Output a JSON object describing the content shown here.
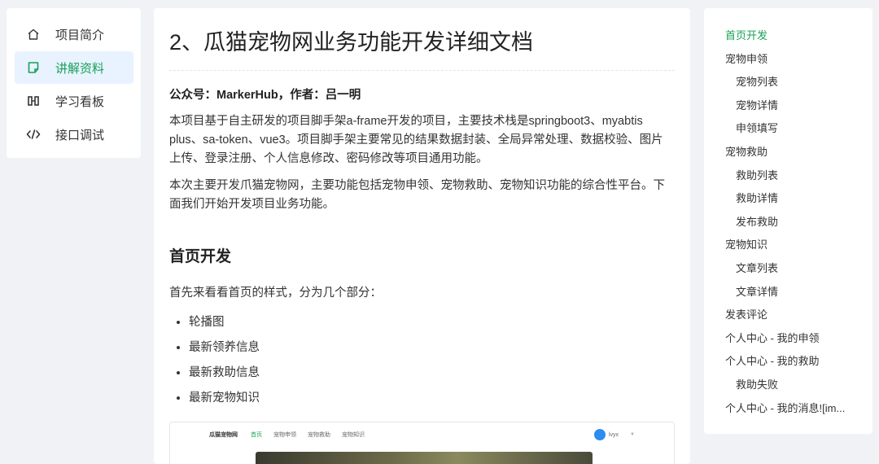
{
  "nav": {
    "items": [
      {
        "label": "项目简介",
        "icon": "home-icon"
      },
      {
        "label": "讲解资料",
        "icon": "note-icon",
        "active": true
      },
      {
        "label": "学习看板",
        "icon": "board-icon"
      },
      {
        "label": "接口调试",
        "icon": "code-icon"
      }
    ],
    "accent_color": "#18a058",
    "active_bg": "#e8f3ff"
  },
  "doc": {
    "title": "2、瓜猫宠物网业务功能开发详细文档",
    "byline": "公众号：MarkerHub，作者：吕一明",
    "para1": "本项目基于自主研发的项目脚手架a-frame开发的项目，主要技术栈是springboot3、myabtis plus、sa-token、vue3。项目脚手架主要常见的结果数据封装、全局异常处理、数据校验、图片上传、登录注册、个人信息修改、密码修改等项目通用功能。",
    "para2": "本次主要开发爪猫宠物网，主要功能包括宠物申领、宠物救助、宠物知识功能的综合性平台。下面我们开始开发项目业务功能。",
    "section_heading": "首页开发",
    "section_intro": "首先来看看首页的样式，分为几个部分：",
    "bullets": [
      "轮播图",
      "最新领养信息",
      "最新救助信息",
      "最新宠物知识"
    ],
    "screenshot": {
      "logo": "瓜猫宠物网",
      "tabs": [
        "首页",
        "宠物申领",
        "宠物救助",
        "宠物知识"
      ],
      "user": "lvyx"
    }
  },
  "toc": {
    "items": [
      {
        "label": "首页开发",
        "level": 1,
        "active": true
      },
      {
        "label": "宠物申领",
        "level": 1
      },
      {
        "label": "宠物列表",
        "level": 2
      },
      {
        "label": "宠物详情",
        "level": 2
      },
      {
        "label": "申领填写",
        "level": 2
      },
      {
        "label": "宠物救助",
        "level": 1
      },
      {
        "label": "救助列表",
        "level": 2
      },
      {
        "label": "救助详情",
        "level": 2
      },
      {
        "label": "发布救助",
        "level": 2
      },
      {
        "label": "宠物知识",
        "level": 1
      },
      {
        "label": "文章列表",
        "level": 2
      },
      {
        "label": "文章详情",
        "level": 2
      },
      {
        "label": "发表评论",
        "level": 1
      },
      {
        "label": "个人中心 - 我的申领",
        "level": 1
      },
      {
        "label": "个人中心 - 我的救助",
        "level": 1
      },
      {
        "label": "救助失败",
        "level": 2
      },
      {
        "label": "个人中心 - 我的消息![im...",
        "level": 1
      }
    ]
  }
}
